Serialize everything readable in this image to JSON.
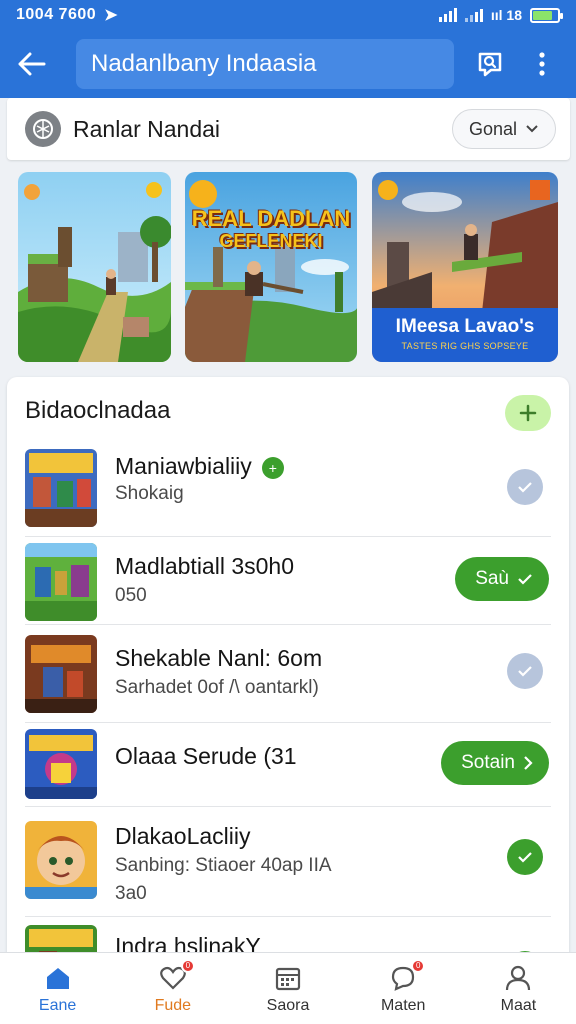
{
  "status_bar": {
    "time": "1004 7600",
    "network": "ııl 18",
    "battery_level": 0.8
  },
  "app_bar": {
    "title": "Nadanlbany Indaasia",
    "icons": [
      "back-arrow-icon",
      "search-chat-icon",
      "more-vert-icon"
    ]
  },
  "filter_bar": {
    "title": "Ranlar Nandai",
    "dropdown_label": "Gonal"
  },
  "banners": [
    {
      "title": "",
      "subtitle": ""
    },
    {
      "title": "REAL DADLAN",
      "subtitle": "GEFLENEKI"
    },
    {
      "title": "",
      "caption": "IMeesa Lavao's",
      "caption_sub": "TASTES RIG GHS SOPSEYE"
    }
  ],
  "list": {
    "title": "Bidaoclnadaa",
    "items": [
      {
        "title": "Maniawbialiiy",
        "subtitle": "Shokaig",
        "subtitle2": "",
        "action": "check-grey",
        "has_badge": true,
        "badge_symbol": "+"
      },
      {
        "title": "Madlabtiall 3s0h0",
        "subtitle": "050",
        "subtitle2": "",
        "action": "pill",
        "action_label": "Saù"
      },
      {
        "title": "Shekable Nanl: 6om",
        "subtitle": "Sarhadet 0of /\\ oantarkl)",
        "subtitle2": "",
        "action": "check-grey"
      },
      {
        "title": "Olaaa Serude (31",
        "subtitle": "",
        "subtitle2": "",
        "action": "pill",
        "action_label": "Sotain"
      },
      {
        "title": "DlakaoLacliiy",
        "subtitle": "Sanbing: Stiaoer 40ap IIA",
        "subtitle2": "3a0",
        "action": "check-green"
      },
      {
        "title": "Indra hslinakY",
        "subtitle": "",
        "subtitle2": "",
        "action": "check-green"
      }
    ]
  },
  "bottom_nav": [
    {
      "label": "Eane",
      "icon": "home-icon",
      "active": true,
      "badge": ""
    },
    {
      "label": "Fude",
      "icon": "heart-icon",
      "active": false,
      "badge": "0"
    },
    {
      "label": "Saora",
      "icon": "calendar-icon",
      "active": false,
      "badge": ""
    },
    {
      "label": "Maten",
      "icon": "chat-icon",
      "active": false,
      "badge": "0"
    },
    {
      "label": "Maat",
      "icon": "profile-icon",
      "active": false,
      "badge": ""
    }
  ],
  "colors": {
    "primary": "#2a73d8",
    "accent_green": "#3c9f2d",
    "light_green": "#c9f3a8",
    "grey_check": "#b7c5dc",
    "badge_red": "#e53935"
  }
}
